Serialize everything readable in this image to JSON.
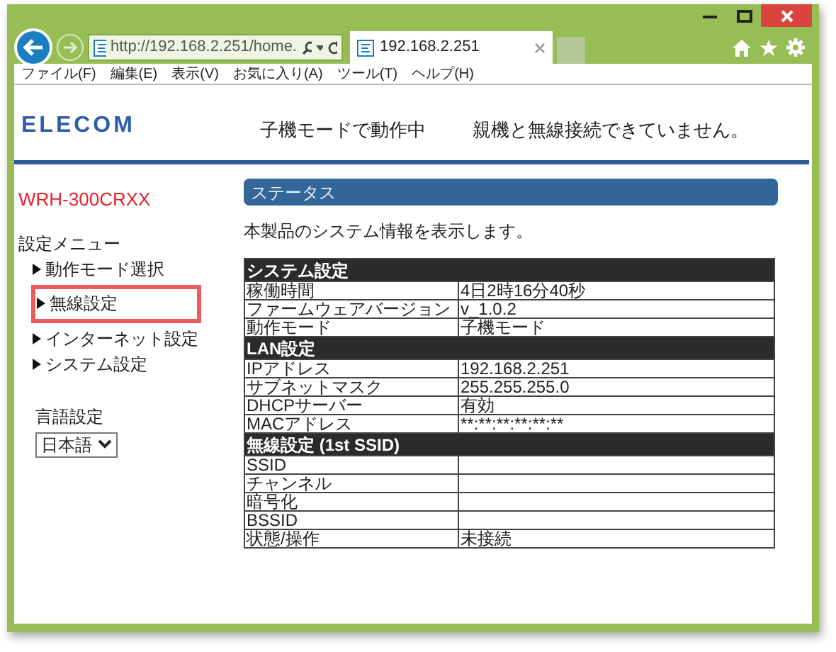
{
  "window": {
    "url": "http://192.168.2.251/home.",
    "tab_title": "192.168.2.251",
    "menu": [
      "ファイル(F)",
      "編集(E)",
      "表示(V)",
      "お気に入り(A)",
      "ツール(T)",
      "ヘルプ(H)"
    ]
  },
  "header": {
    "logo": "ELECOM",
    "mode": "子機モードで動作中",
    "status": "親機と無線接続できていません。"
  },
  "sidebar": {
    "model": "WRH-300CRXX",
    "menu_title": "設定メニュー",
    "items": [
      {
        "label": "動作モード選択",
        "highlighted": false
      },
      {
        "label": "無線設定",
        "highlighted": true
      },
      {
        "label": "インターネット設定",
        "highlighted": false
      },
      {
        "label": "システム設定",
        "highlighted": false
      }
    ],
    "language": {
      "label": "言語設定",
      "value": "日本語"
    }
  },
  "content": {
    "heading": "ステータス",
    "description": "本製品のシステム情報を表示します。",
    "sections": [
      {
        "title": "システム設定",
        "rows": [
          {
            "label": "稼働時間",
            "value": "4日2時16分40秒"
          },
          {
            "label": "ファームウェアバージョン",
            "value": "v_1.0.2"
          },
          {
            "label": "動作モード",
            "value": "子機モード"
          }
        ]
      },
      {
        "title": "LAN設定",
        "rows": [
          {
            "label": "IPアドレス",
            "value": "192.168.2.251"
          },
          {
            "label": "サブネットマスク",
            "value": "255.255.255.0"
          },
          {
            "label": "DHCPサーバー",
            "value": "有効"
          },
          {
            "label": "MACアドレス",
            "value": "**:**:**:**:**:**"
          }
        ]
      },
      {
        "title": "無線設定 (1st SSID)",
        "rows": [
          {
            "label": "SSID"
          },
          {
            "label": "チャンネル"
          },
          {
            "label": "暗号化"
          },
          {
            "label": "BSSID"
          },
          {
            "label": "状態/操作",
            "value": "未接続"
          }
        ]
      }
    ]
  }
}
